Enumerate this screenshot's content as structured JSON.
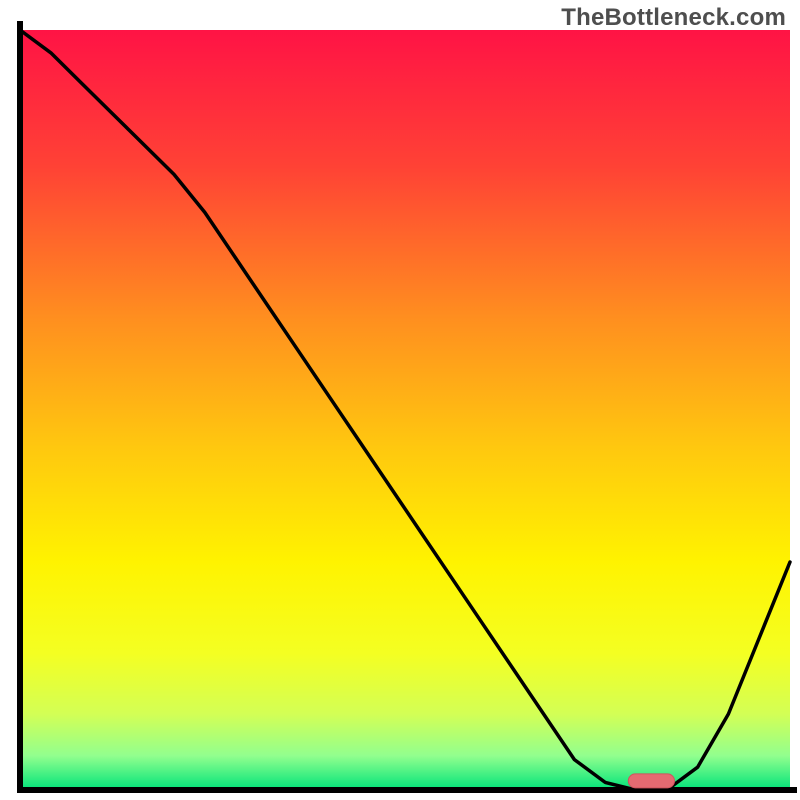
{
  "watermark": "TheBottleneck.com",
  "chart_data": {
    "type": "line",
    "title": "",
    "xlabel": "",
    "ylabel": "",
    "xlim": [
      0,
      100
    ],
    "ylim": [
      0,
      100
    ],
    "x": [
      0,
      4,
      8,
      12,
      16,
      20,
      24,
      28,
      32,
      36,
      40,
      44,
      48,
      52,
      56,
      60,
      64,
      68,
      72,
      76,
      80,
      84,
      88,
      92,
      96,
      100
    ],
    "values": [
      100,
      97,
      93,
      89,
      85,
      81,
      76,
      70,
      64,
      58,
      52,
      46,
      40,
      34,
      28,
      22,
      16,
      10,
      4,
      1,
      0,
      0,
      3,
      10,
      20,
      30
    ],
    "marker": {
      "x_start": 79,
      "x_end": 85,
      "y": 1.2
    },
    "background_gradient": {
      "stops": [
        {
          "offset": 0.0,
          "color": "#ff1345"
        },
        {
          "offset": 0.18,
          "color": "#ff4235"
        },
        {
          "offset": 0.38,
          "color": "#ff8f1f"
        },
        {
          "offset": 0.55,
          "color": "#ffc80f"
        },
        {
          "offset": 0.7,
          "color": "#fff300"
        },
        {
          "offset": 0.82,
          "color": "#f4ff22"
        },
        {
          "offset": 0.9,
          "color": "#d3ff55"
        },
        {
          "offset": 0.955,
          "color": "#92ff8e"
        },
        {
          "offset": 1.0,
          "color": "#00e37a"
        }
      ]
    },
    "colors": {
      "line": "#000000",
      "axis": "#000000",
      "marker_fill": "#e46a71",
      "marker_stroke": "#cf545d"
    }
  }
}
